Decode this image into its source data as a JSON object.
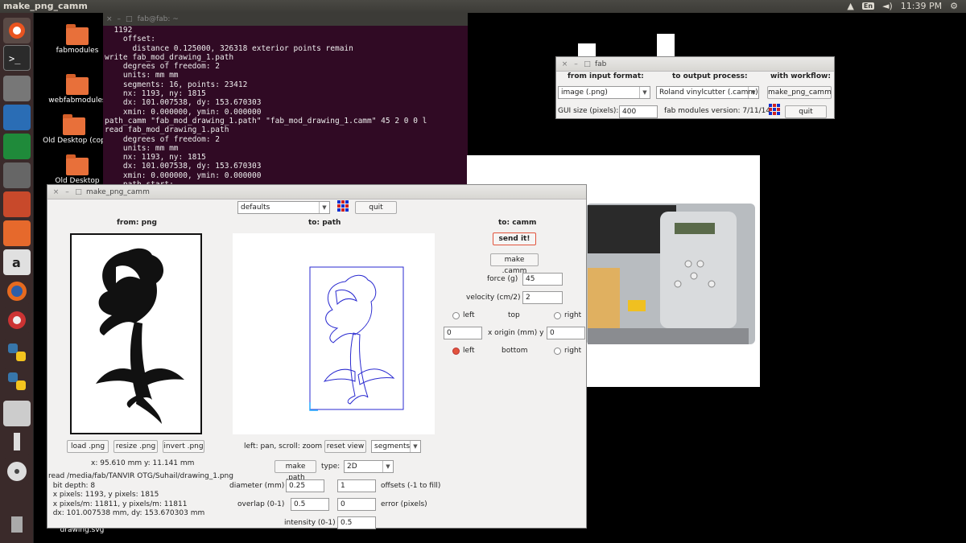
{
  "topbar": {
    "app_title": "make_png_camm",
    "lang": "En",
    "clock": "11:39 PM"
  },
  "desktop": {
    "icons": [
      "fabmodules",
      "webfabmodules",
      "Old Desktop (cop",
      "Old Desktop",
      "drawing.svg"
    ]
  },
  "terminal": {
    "title": "fab@fab: ~",
    "lines": "  1192\n    offset:\n      distance 0.125000, 326318 exterior points remain\nwrite fab_mod_drawing_1.path\n    degrees of freedom: 2\n    units: mm mm\n    segments: 16, points: 23412\n    nx: 1193, ny: 1815\n    dx: 101.007538, dy: 153.670303\n    xmin: 0.000000, ymin: 0.000000\npath_camm \"fab_mod_drawing_1.path\" \"fab_mod_drawing_1.camm\" 45 2 0 0 l\nread fab_mod_drawing_1.path\n    degrees of freedom: 2\n    units: mm mm\n    nx: 1193, ny: 1815\n    dx: 101.007538, dy: 153.670303\n    xmin: 0.000000, ymin: 0.000000\n    path start:"
  },
  "fab": {
    "title": "fab",
    "from_label": "from input format:",
    "to_label": "to output process:",
    "workflow_label": "with workflow:",
    "input_format": "image (.png)",
    "output_process": "Roland vinylcutter (.camm)",
    "workflow": "make_png_camm",
    "gui_size_label": "GUI size (pixels):",
    "gui_size": "400",
    "version": "fab modules version: 7/11/14",
    "quit": "quit"
  },
  "main": {
    "title": "make_png_camm",
    "defaults": "defaults",
    "quit": "quit",
    "from_png": "from: png",
    "to_path": "to: path",
    "to_camm": "to: camm",
    "load_png": "load .png",
    "resize_png": "resize .png",
    "invert_png": "invert .png",
    "coords": "x: 95.610 mm  y: 11.141 mm",
    "info": [
      "read /media/fab/TANVIR OTG/Suhail/drawing_1.png",
      "  bit depth: 8",
      "  x pixels: 1193, y pixels: 1815",
      "  x pixels/m: 11811, y pixels/m: 11811",
      "  dx: 101.007538 mm, dy: 153.670303 mm"
    ],
    "pan_hint": "left: pan, scroll: zoom",
    "reset_view": "reset view",
    "segments": "segments",
    "make_path": "make .path",
    "type_label": "type:",
    "type_value": "2D",
    "diameter_label": "diameter (mm)",
    "diameter": "0.25",
    "offsets": "1",
    "offsets_label": "offsets (-1 to fill)",
    "overlap_label": "overlap (0-1)",
    "overlap": "0.5",
    "error": "0",
    "error_label": "error (pixels)",
    "intensity_label": "intensity (0-1)",
    "intensity": "0.5",
    "send_it": "send it!",
    "make_camm": "make .camm",
    "force_label": "force (g)",
    "force": "45",
    "velocity_label": "velocity (cm/2)",
    "velocity": "2",
    "left": "left",
    "top": "top",
    "right": "right",
    "bottom": "bottom",
    "x_origin": "0",
    "origin_label": "x  origin (mm)  y",
    "y_origin": "0"
  }
}
